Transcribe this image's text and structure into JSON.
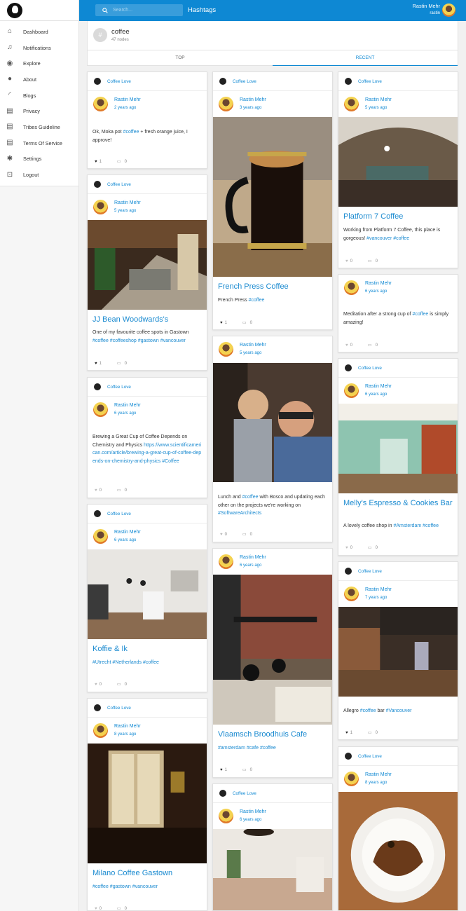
{
  "sidebar": {
    "items": [
      {
        "label": "Dashboard",
        "icon": "home-icon"
      },
      {
        "label": "Notifications",
        "icon": "bell-icon"
      },
      {
        "label": "Explore",
        "icon": "compass-icon"
      },
      {
        "label": "About",
        "icon": "info-icon"
      },
      {
        "label": "Blogs",
        "icon": "rss-icon"
      },
      {
        "label": "Privacy",
        "icon": "document-icon"
      },
      {
        "label": "Tribes Guideline",
        "icon": "document-icon"
      },
      {
        "label": "Terms Of Service",
        "icon": "document-icon"
      },
      {
        "label": "Settings",
        "icon": "gear-icon"
      },
      {
        "label": "Logout",
        "icon": "lock-icon"
      }
    ]
  },
  "topbar": {
    "search_placeholder": "Search...",
    "title": "Hashtags",
    "user_name": "Rastin Mehr",
    "user_handle": "rastin",
    "accent": "#0e88d3"
  },
  "hashtag": {
    "name": "coffee",
    "count": "47 nodes",
    "symbol": "#"
  },
  "tabs": {
    "top": "TOP",
    "recent": "RECENT"
  },
  "posts": [
    {
      "tribe": "Coffee Love",
      "author": "Rastin Mehr",
      "time": "2 years ago",
      "title": "",
      "text": "Ok, Moka pot #coffee + fresh orange juice, I approve!",
      "likes": "1",
      "comments": "0"
    },
    {
      "tribe": "Coffee Love",
      "author": "Rastin Mehr",
      "time": "5 years ago",
      "title": "JJ Bean Woodwards's",
      "text": "One of my favourite coffee spots in Gastown #coffee #coffeeshop #gastown #vancouver",
      "likes": "1",
      "comments": "0"
    },
    {
      "tribe": "Coffee Love",
      "author": "Rastin Mehr",
      "time": "6 years ago",
      "title": "",
      "text": "Brewing a Great Cup of Coffee Depends on Chemistry and Physics",
      "link": "https://www.scientificamerican.com/article/brewing-a-great-cup-of-coffee-depends-on-chemistry-and-physics",
      "tags": "#Coffee",
      "likes": "0",
      "comments": "0"
    },
    {
      "tribe": "Coffee Love",
      "author": "Rastin Mehr",
      "time": "6 years ago",
      "title": "Koffie & Ik",
      "text": "#Utrecht #Netherlands #coffee",
      "likes": "0",
      "comments": "0"
    },
    {
      "tribe": "Coffee Love",
      "author": "Rastin Mehr",
      "time": "8 years ago",
      "title": "Milano Coffee Gastown",
      "text": "#coffee #gastown #vancouver",
      "likes": "0",
      "comments": "0"
    },
    {
      "tribe": "Coffee Love",
      "author": "Rastin Mehr",
      "time": "3 years ago",
      "title": "French Press Coffee",
      "text": "French Press #coffee",
      "likes": "1",
      "comments": "0"
    },
    {
      "tribe": "",
      "author": "Rastin Mehr",
      "time": "5 years ago",
      "title": "",
      "text": "Lunch and #coffee with Bosco and updating each other on the projects we're working on #SoftwareArchitects",
      "likes": "0",
      "comments": "0"
    },
    {
      "tribe": "",
      "author": "Rastin Mehr",
      "time": "6 years ago",
      "title": "Vlaamsch Broodhuis Cafe",
      "text": "#amsterdam #cafe #coffee",
      "likes": "1",
      "comments": "0"
    },
    {
      "tribe": "Coffee Love",
      "author": "Rastin Mehr",
      "time": "6 years ago",
      "title": "",
      "text": "",
      "likes": "",
      "comments": ""
    },
    {
      "tribe": "Coffee Love",
      "author": "Rastin Mehr",
      "time": "5 years ago",
      "title": "Platform 7 Coffee",
      "text": "Working from Platform 7 Coffee, this place is gorgeous! #vancouver #coffee",
      "likes": "0",
      "comments": "0"
    },
    {
      "tribe": "",
      "author": "Rastin Mehr",
      "time": "6 years ago",
      "title": "",
      "text": "Meditation after a strong cup of #coffee is simply amazing!",
      "likes": "0",
      "comments": "0"
    },
    {
      "tribe": "Coffee Love",
      "author": "Rastin Mehr",
      "time": "6 years ago",
      "title": "Melly's Espresso & Cookies Bar",
      "text": "A lovely coffee shop in #Amsterdam #coffee",
      "likes": "0",
      "comments": "0"
    },
    {
      "tribe": "Coffee Love",
      "author": "Rastin Mehr",
      "time": "7 years ago",
      "title": "",
      "text": "Allegro #coffee bar #Vancouver",
      "likes": "1",
      "comments": "0"
    },
    {
      "tribe": "Coffee Love",
      "author": "Rastin Mehr",
      "time": "8 years ago",
      "title": "",
      "text": "",
      "likes": "",
      "comments": ""
    }
  ]
}
